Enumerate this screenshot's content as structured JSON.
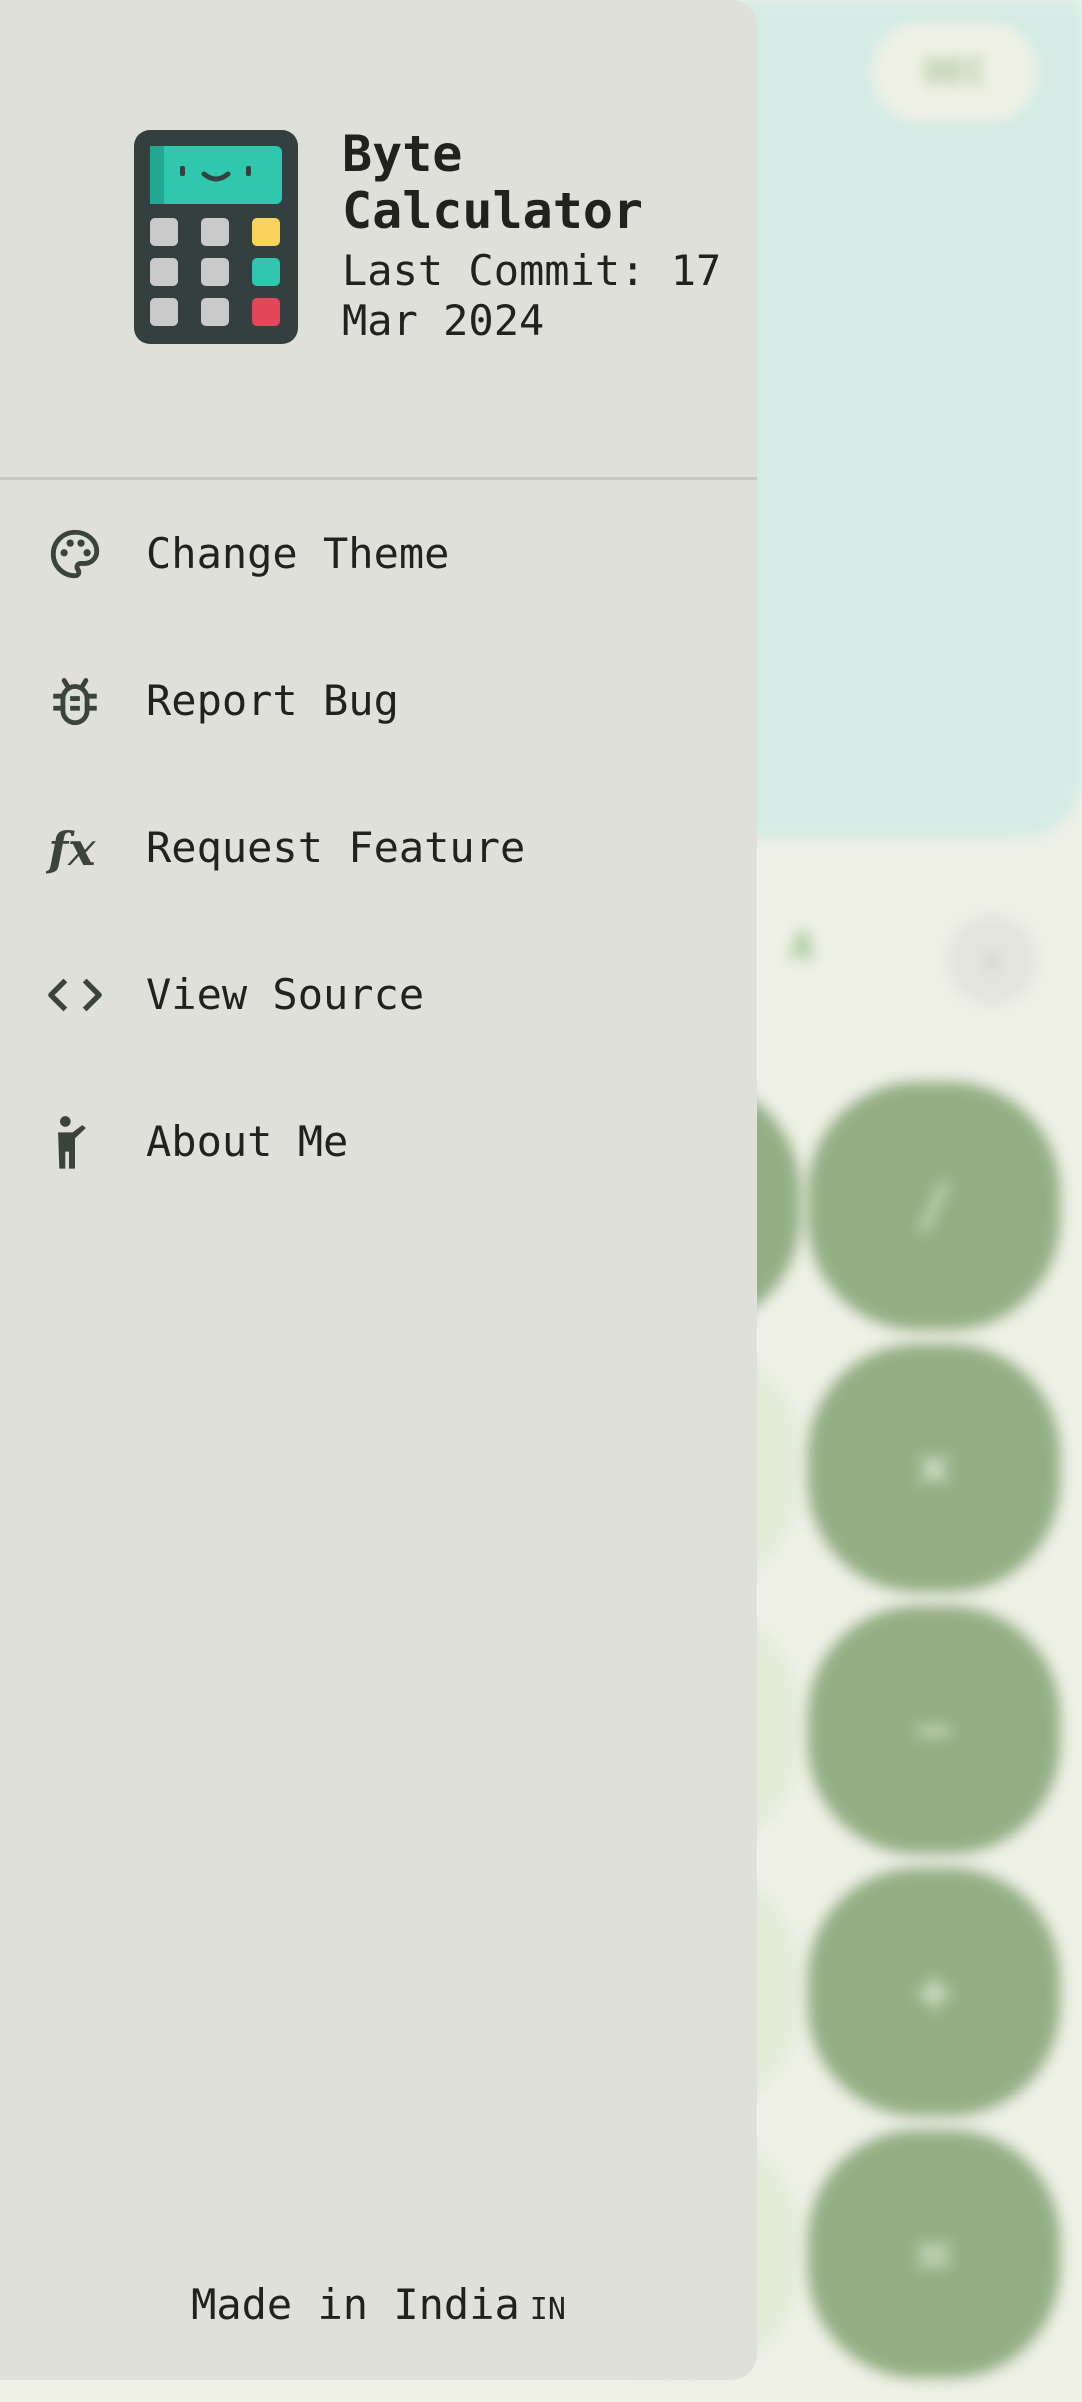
{
  "app": {
    "name": "Byte Calculator",
    "last_commit": "Last Commit: 17 Mar 2024"
  },
  "drawer": {
    "menu": [
      {
        "label": "Change Theme",
        "icon": "palette-icon"
      },
      {
        "label": "Report Bug",
        "icon": "bug-icon"
      },
      {
        "label": "Request Feature",
        "icon": "function-icon"
      },
      {
        "label": "View Source",
        "icon": "code-icon"
      },
      {
        "label": "About Me",
        "icon": "person-waving-icon"
      }
    ],
    "footer": "Made in India",
    "footer_flag": "IN"
  },
  "background": {
    "mode_button": "DEC",
    "row_letter": "A",
    "backspace": "‹",
    "operators": [
      "/",
      "×",
      "−",
      "+",
      "="
    ]
  },
  "colors": {
    "drawer_bg": "#dfe0d9",
    "display_bg": "#d4ebe6",
    "operator_green": "#93ae84",
    "icon_teal": "#2fc7ad",
    "icon_dark": "#33403f"
  }
}
